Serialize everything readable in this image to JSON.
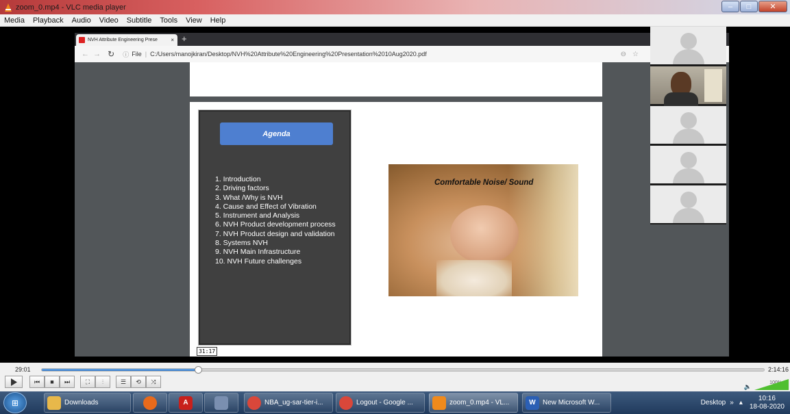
{
  "window": {
    "title": "zoom_0.mp4 - VLC media player"
  },
  "menu": [
    "Media",
    "Playback",
    "Audio",
    "Video",
    "Subtitle",
    "Tools",
    "View",
    "Help"
  ],
  "browser": {
    "tab_title": "NVH Attribute Engineering Prese",
    "tab_close": "×",
    "newtab": "+",
    "info_label": "File",
    "url": "C:/Users/manojkiran/Desktop/NVH%20Attribute%20Engineering%20Presentation%2010Aug2020.pdf"
  },
  "slide": {
    "agenda_title": "Agenda",
    "agenda_items": [
      "1. Introduction",
      "2. Driving factors",
      "3. What /Why  is NVH",
      "4. Cause and Effect of Vibration",
      "5. Instrument and Analysis",
      "6. NVH Product development process",
      "7. NVH Product design and validation",
      "8. Systems NVH",
      "9. NVH Main Infrastructure",
      "10. NVH Future challenges"
    ],
    "image_caption": "Comfortable Noise/ Sound",
    "hover_time": "31:17"
  },
  "player": {
    "elapsed": "29:01",
    "total": "2:14:16",
    "progress_fraction": 0.216,
    "volume": "100%"
  },
  "taskbar": {
    "items": [
      {
        "label": "Downloads",
        "icon": "folder-icon",
        "color": "#e8b84a"
      },
      {
        "label": "",
        "icon": "firefox-icon",
        "color": "#e86a1c"
      },
      {
        "label": "",
        "icon": "acrobat-icon",
        "color": "#c8201c"
      },
      {
        "label": "",
        "icon": "tool-icon",
        "color": "#7a8fb0"
      },
      {
        "label": "NBA_ug-sar-tier-i...",
        "icon": "chrome-icon",
        "color": "#d9473a"
      },
      {
        "label": "Logout - Google ...",
        "icon": "chrome-icon",
        "color": "#d9473a"
      },
      {
        "label": "zoom_0.mp4 - VL...",
        "icon": "vlc-icon",
        "color": "#f08a1c"
      },
      {
        "label": "New Microsoft W...",
        "icon": "word-icon",
        "color": "#2b5fb4"
      }
    ],
    "desktop_label": "Desktop",
    "time": "10:16",
    "date": "18-08-2020"
  }
}
